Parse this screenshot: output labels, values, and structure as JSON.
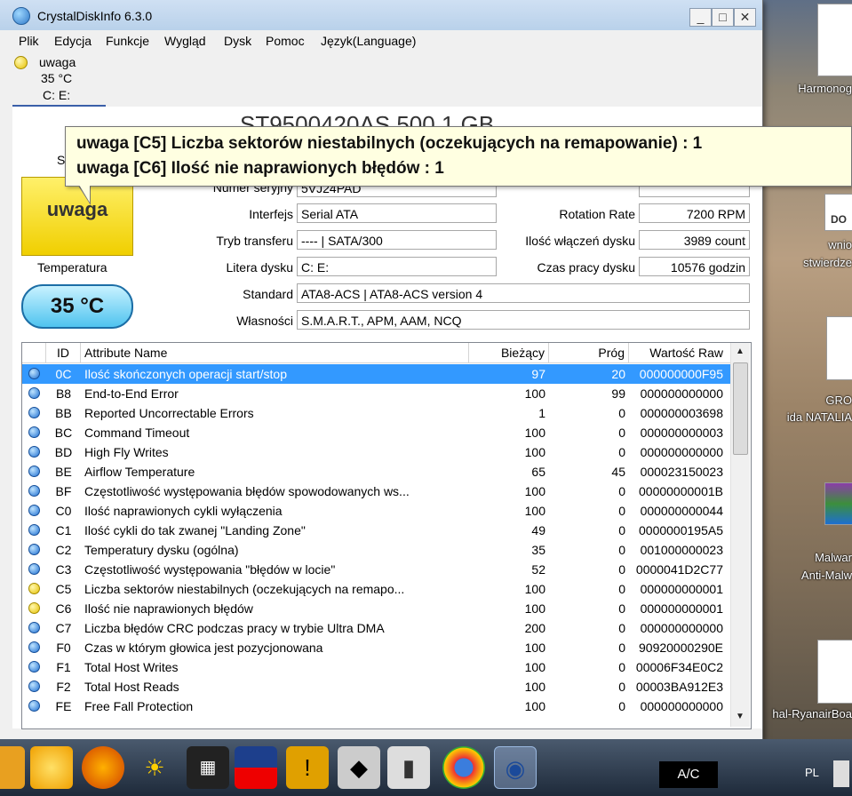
{
  "window": {
    "title": "CrystalDiskInfo 6.3.0",
    "buttons": {
      "minimize": "_",
      "maximize": "□",
      "close": "✕"
    }
  },
  "menu": [
    "Plik",
    "Edycja",
    "Funkcje",
    "Wygląd",
    "Dysk",
    "Pomoc",
    "Język(Language)"
  ],
  "drive_tab": {
    "status": "uwaga",
    "temp": "35 °C",
    "letters": "C: E:"
  },
  "model": "ST9500420AS 500,1 GB",
  "health": {
    "label": "S",
    "value": "uwaga"
  },
  "temperature": {
    "label": "Temperatura",
    "value": "35 °C"
  },
  "tooltip": {
    "line1": "uwaga [C5] Liczba sektorów niestabilnych (oczekujących na remapowanie) : 1",
    "line2": "uwaga [C6] Ilość nie naprawionych błędów : 1"
  },
  "fields": {
    "serial_label": "Numer seryjny",
    "serial_value": "5VJ24PAD",
    "interface_label": "Interfejs",
    "interface_value": "Serial ATA",
    "transfer_label": "Tryb transferu",
    "transfer_value": "---- | SATA/300",
    "letter_label": "Litera dysku",
    "letter_value": "C: E:",
    "standard_label": "Standard",
    "standard_value": "ATA8-ACS | ATA8-ACS version 4",
    "features_label": "Własności",
    "features_value": "S.M.A.R.T., APM, AAM, NCQ",
    "rotation_label": "Rotation Rate",
    "rotation_value": "7200 RPM",
    "poweron_count_label": "Ilość włączeń dysku",
    "poweron_count_value": "3989 count",
    "poweron_hours_label": "Czas pracy dysku",
    "poweron_hours_value": "10576 godzin"
  },
  "table": {
    "headers": {
      "id": "ID",
      "name": "Attribute Name",
      "current": "Bieżący",
      "threshold": "Próg",
      "raw": "Wartość Raw"
    },
    "rows": [
      {
        "status": "good",
        "id": "0C",
        "name": "Ilość skończonych operacji start/stop",
        "current": "97",
        "threshold": "20",
        "raw": "000000000F95"
      },
      {
        "status": "good",
        "id": "B8",
        "name": "End-to-End Error",
        "current": "100",
        "threshold": "99",
        "raw": "000000000000"
      },
      {
        "status": "good",
        "id": "BB",
        "name": "Reported Uncorrectable Errors",
        "current": "1",
        "threshold": "0",
        "raw": "000000003698"
      },
      {
        "status": "good",
        "id": "BC",
        "name": "Command Timeout",
        "current": "100",
        "threshold": "0",
        "raw": "000000000003"
      },
      {
        "status": "good",
        "id": "BD",
        "name": "High Fly Writes",
        "current": "100",
        "threshold": "0",
        "raw": "000000000000"
      },
      {
        "status": "good",
        "id": "BE",
        "name": "Airflow Temperature",
        "current": "65",
        "threshold": "45",
        "raw": "000023150023"
      },
      {
        "status": "good",
        "id": "BF",
        "name": "Częstotliwość występowania błędów spowodowanych ws...",
        "current": "100",
        "threshold": "0",
        "raw": "00000000001B"
      },
      {
        "status": "good",
        "id": "C0",
        "name": "Ilość naprawionych cykli wyłączenia",
        "current": "100",
        "threshold": "0",
        "raw": "000000000044"
      },
      {
        "status": "good",
        "id": "C1",
        "name": "Ilość cykli do tak zwanej \"Landing Zone\"",
        "current": "49",
        "threshold": "0",
        "raw": "0000000195A5"
      },
      {
        "status": "good",
        "id": "C2",
        "name": "Temperatury dysku (ogólna)",
        "current": "35",
        "threshold": "0",
        "raw": "001000000023"
      },
      {
        "status": "good",
        "id": "C3",
        "name": "Częstotliwość występowania \"błędów w locie\"",
        "current": "52",
        "threshold": "0",
        "raw": "0000041D2C77"
      },
      {
        "status": "warn",
        "id": "C5",
        "name": "Liczba sektorów niestabilnych (oczekujących na remapo...",
        "current": "100",
        "threshold": "0",
        "raw": "000000000001"
      },
      {
        "status": "warn",
        "id": "C6",
        "name": "Ilość nie naprawionych błędów",
        "current": "100",
        "threshold": "0",
        "raw": "000000000001"
      },
      {
        "status": "good",
        "id": "C7",
        "name": "Liczba błędów CRC podczas pracy w trybie Ultra DMA",
        "current": "200",
        "threshold": "0",
        "raw": "000000000000"
      },
      {
        "status": "good",
        "id": "F0",
        "name": "Czas w którym głowica jest pozycjonowana",
        "current": "100",
        "threshold": "0",
        "raw": "90920000290E"
      },
      {
        "status": "good",
        "id": "F1",
        "name": "Total Host Writes",
        "current": "100",
        "threshold": "0",
        "raw": "00006F34E0C2"
      },
      {
        "status": "good",
        "id": "F2",
        "name": "Total Host Reads",
        "current": "100",
        "threshold": "0",
        "raw": "00003BA912E3"
      },
      {
        "status": "good",
        "id": "FE",
        "name": "Free Fall Protection",
        "current": "100",
        "threshold": "0",
        "raw": "000000000000"
      }
    ]
  },
  "desktop": {
    "items": [
      "Harmonog",
      "DO",
      "wnio",
      "stwierdze",
      "GRO",
      "ida  NATALIA",
      "Malwar",
      "Anti-Malw",
      "hal-RyanairBoa"
    ]
  },
  "taskbar": {
    "ac_label": "A/C",
    "language": "PL"
  },
  "colors": {
    "selection": "#3399ff",
    "warning": "#f0cf00",
    "good": "#1f6fd1",
    "temp_box": "#4fc3ef"
  }
}
